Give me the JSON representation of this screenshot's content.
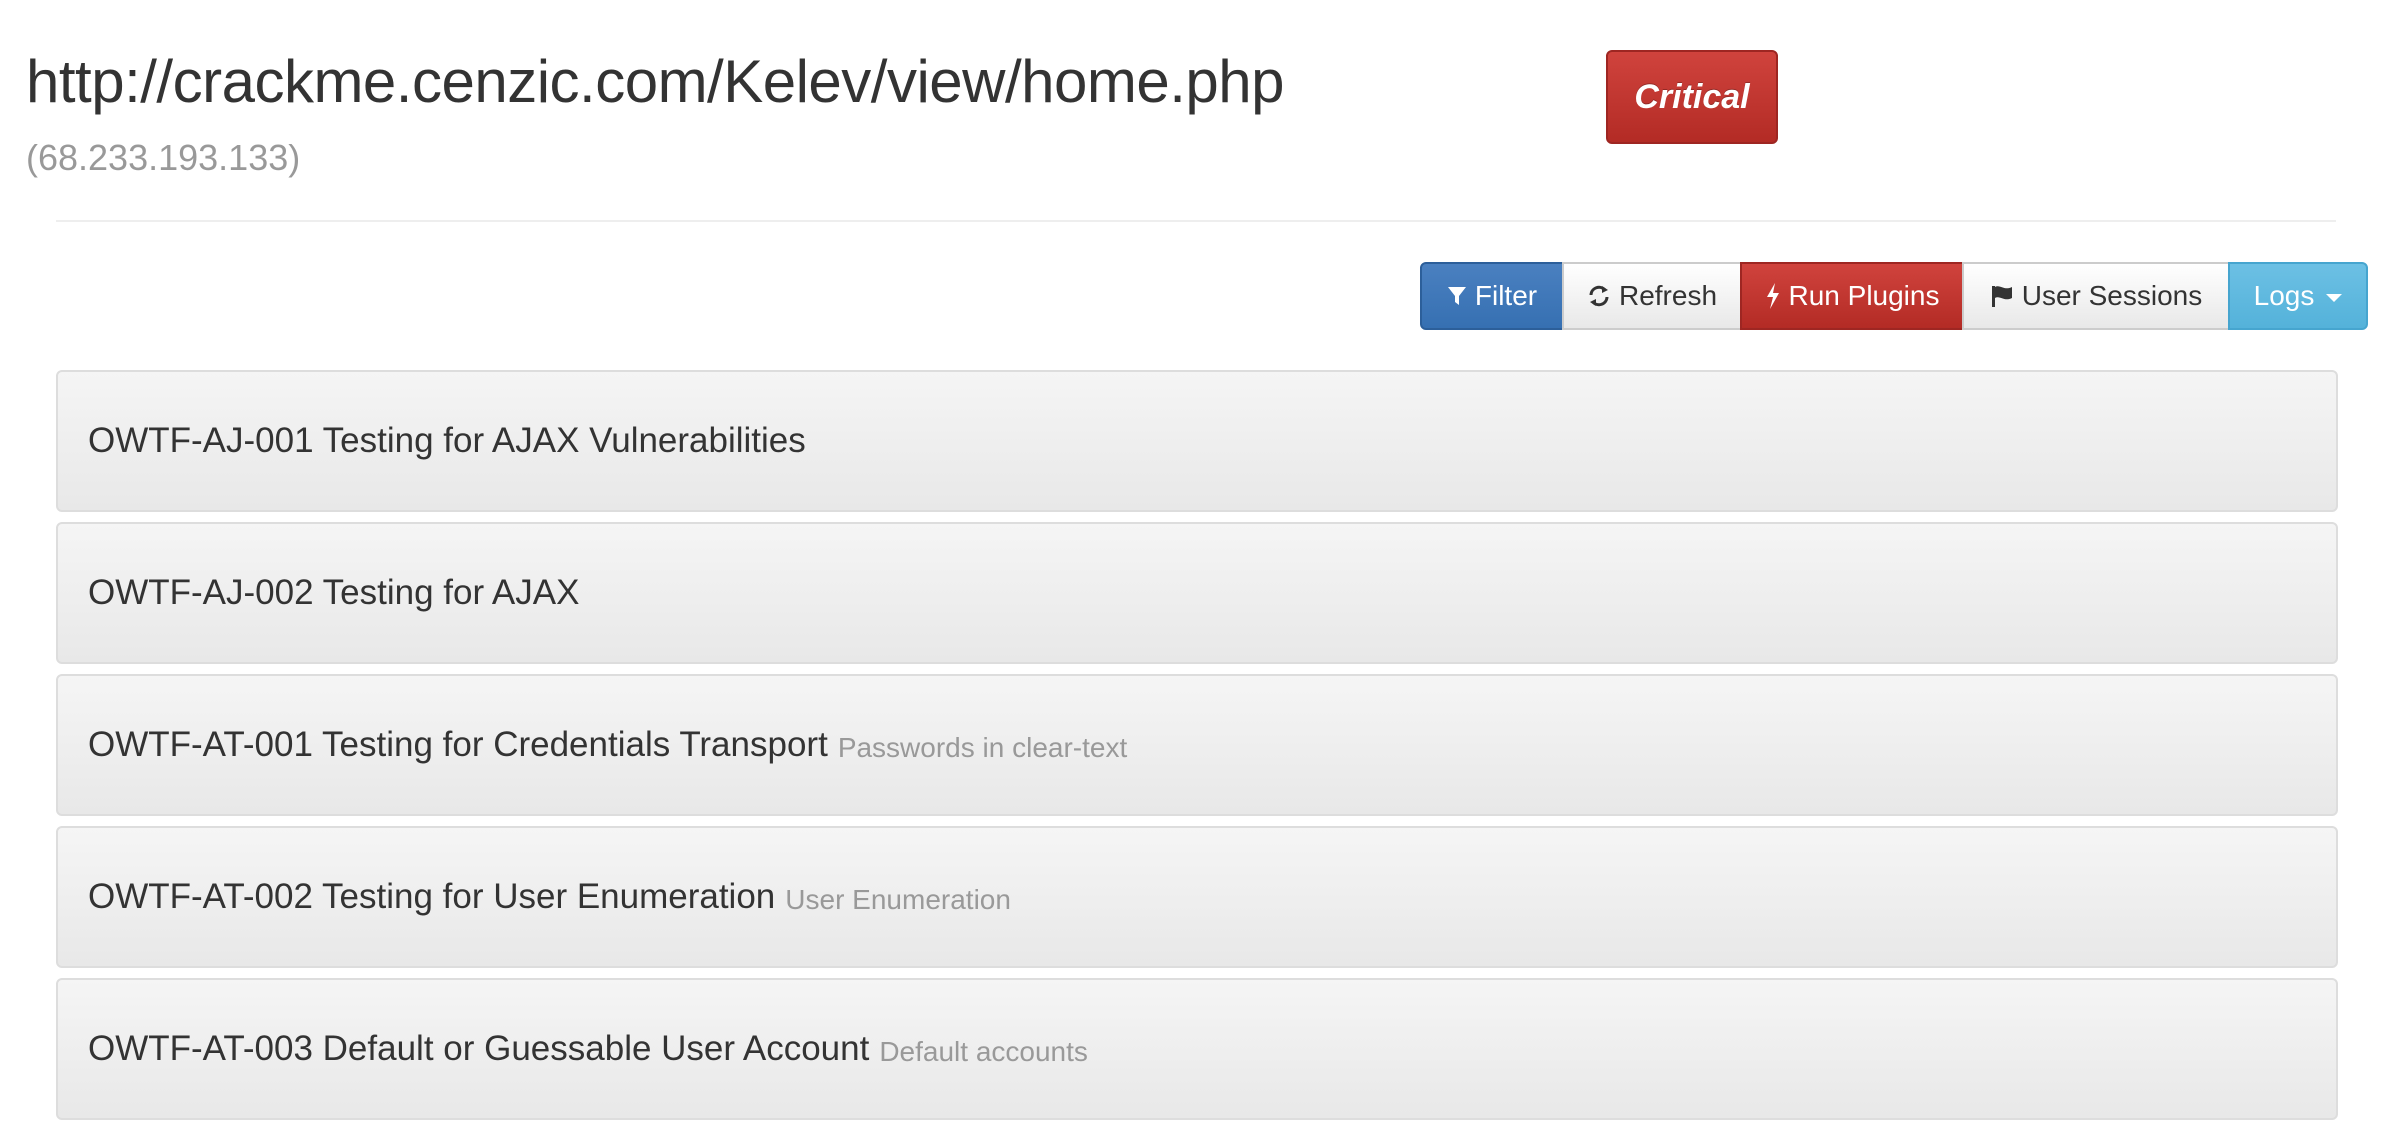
{
  "header": {
    "url": "http://crackme.cenzic.com/Kelev/view/home.php",
    "ip": "(68.233.193.133)",
    "severity": "Critical",
    "severity_color": "#c9302c"
  },
  "toolbar": {
    "filter_label": "Filter",
    "filter_icon": "filter-icon",
    "refresh_label": "Refresh",
    "refresh_icon": "refresh-icon",
    "run_label": "Run Plugins",
    "run_icon": "bolt-icon",
    "sessions_label": "User Sessions",
    "sessions_icon": "flag-icon",
    "logs_label": "Logs",
    "colors": {
      "filter": "#3b74b6",
      "run": "#c9302c",
      "logs": "#5bc0de"
    }
  },
  "panels": [
    {
      "title": "OWTF-AJ-001 Testing for AJAX Vulnerabilities",
      "subtitle": ""
    },
    {
      "title": "OWTF-AJ-002 Testing for AJAX",
      "subtitle": ""
    },
    {
      "title": "OWTF-AT-001 Testing for Credentials Transport",
      "subtitle": "Passwords in clear-text"
    },
    {
      "title": "OWTF-AT-002 Testing for User Enumeration",
      "subtitle": "User Enumeration"
    },
    {
      "title": "OWTF-AT-003 Default or Guessable User Account",
      "subtitle": "Default accounts"
    }
  ]
}
